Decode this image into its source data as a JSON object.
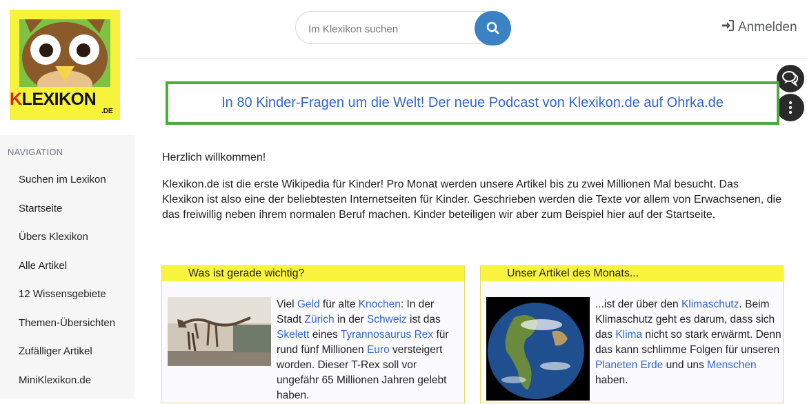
{
  "logo": {
    "text_k": "K",
    "text_rest": "LEXIKON",
    "text_de": ".DE"
  },
  "sidebar": {
    "heading": "NAVIGATION",
    "items": [
      {
        "label": "Suchen im Lexikon"
      },
      {
        "label": "Startseite"
      },
      {
        "label": "Übers Klexikon"
      },
      {
        "label": "Alle Artikel"
      },
      {
        "label": "12 Wissensgebiete"
      },
      {
        "label": "Themen-Übersichten"
      },
      {
        "label": "Zufälliger Artikel"
      },
      {
        "label": "MiniKlexikon.de"
      }
    ]
  },
  "header": {
    "search_placeholder": "Im Klexikon suchen",
    "login_label": "Anmelden"
  },
  "banner": {
    "text": "In 80 Kinder-Fragen um die Welt! Der neue Podcast von Klexikon.de auf Ohrka.de"
  },
  "main": {
    "welcome": "Herzlich willkommen!",
    "intro": "Klexikon.de ist die erste Wikipedia für Kinder! Pro Monat werden unsere Artikel bis zu zwei Millionen Mal besucht. Das Klexikon ist also eine der beliebtesten Internetseiten für Kinder. Geschrieben werden die Texte vor allem von Erwachsenen, die das freiwillig neben ihrem normalen Beruf machen. Kinder beteiligen wir aber zum Beispiel hier auf der Startseite."
  },
  "box_news": {
    "title": "Was ist gerade wichtig?",
    "t1": "Viel ",
    "l1": "Geld",
    "t2": " für alte ",
    "l2": "Knochen",
    "t3": ": In der Stadt ",
    "l3": "Zürich",
    "t4": " in der ",
    "l4": "Schweiz",
    "t5": " ist das ",
    "l5": "Skelett",
    "t6": " eines ",
    "l6": "Tyrannosaurus Rex",
    "t7": " für rund fünf Millionen ",
    "l7": "Euro",
    "t8": " versteigert worden. Dieser T-Rex soll vor ungefähr 65 Millionen Jahren gelebt haben."
  },
  "box_month": {
    "title": "Unser Artikel des Monats...",
    "t1": "...ist der über den ",
    "l1": "Klimaschutz",
    "t2": ". Beim Klimaschutz geht es darum, dass sich das ",
    "l2": "Klima",
    "t3": " nicht so stark erwärmt. Denn das kann schlimme Folgen für unseren ",
    "l3": "Planeten",
    "t4": " ",
    "l4": "Erde",
    "t5": " und uns ",
    "l5": "Menschen",
    "t6": " haben."
  },
  "colors": {
    "link": "#3366cc",
    "banner_border": "#4caa3f",
    "box_header": "#fbf43f",
    "search_button": "#3b82c4",
    "logo_bg": "#f7f33b"
  }
}
